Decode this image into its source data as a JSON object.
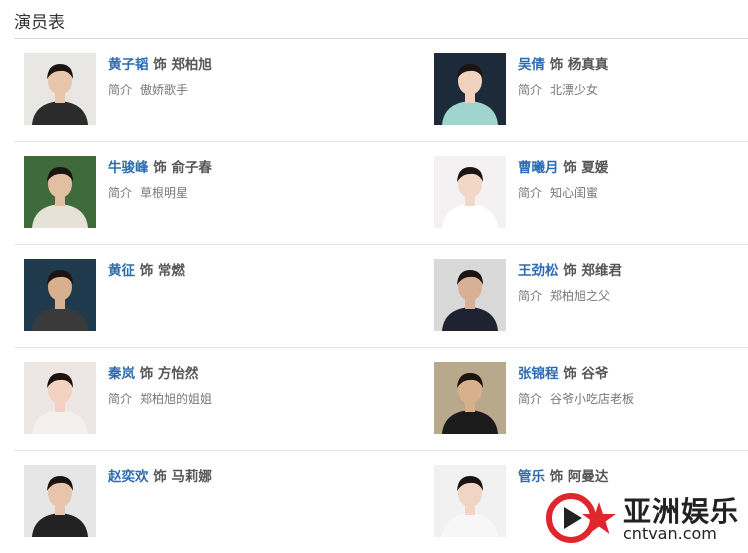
{
  "section_title": "演员表",
  "cast": [
    {
      "actor": "黄子韬",
      "sep": "饰",
      "role": "郑柏旭",
      "intro_label": "简介",
      "intro": "傲娇歌手",
      "photo_bg": "#e9e7e4",
      "photo_fg": "#2b2b2b",
      "skin": "#e8c6ac"
    },
    {
      "actor": "吴倩",
      "sep": "饰",
      "role": "杨真真",
      "intro_label": "简介",
      "intro": "北漂少女",
      "photo_bg": "#1d2a3a",
      "photo_fg": "#9fd4cf",
      "skin": "#f0d2bf"
    },
    {
      "actor": "牛骏峰",
      "sep": "饰",
      "role": "俞子春",
      "intro_label": "简介",
      "intro": "草根明星",
      "photo_bg": "#3f6b3a",
      "photo_fg": "#e7e2d6",
      "skin": "#e3bfa2"
    },
    {
      "actor": "曹曦月",
      "sep": "饰",
      "role": "夏媛",
      "intro_label": "简介",
      "intro": "知心闺蜜",
      "photo_bg": "#f3f1f1",
      "photo_fg": "#ffffff",
      "skin": "#f2d6c6"
    },
    {
      "actor": "黄征",
      "sep": "饰",
      "role": "常燃",
      "intro_label": "",
      "intro": "",
      "photo_bg": "#1e3a4c",
      "photo_fg": "#3a3a3a",
      "skin": "#d9b08e"
    },
    {
      "actor": "王劲松",
      "sep": "饰",
      "role": "郑维君",
      "intro_label": "简介",
      "intro": "郑柏旭之父",
      "photo_bg": "#d9d9d9",
      "photo_fg": "#1f2230",
      "skin": "#d7b095"
    },
    {
      "actor": "秦岚",
      "sep": "饰",
      "role": "方怡然",
      "intro_label": "简介",
      "intro": "郑柏旭的姐姐",
      "photo_bg": "#ece6e4",
      "photo_fg": "#f4f0ee",
      "skin": "#f2d3c2"
    },
    {
      "actor": "张锦程",
      "sep": "饰",
      "role": "谷爷",
      "intro_label": "简介",
      "intro": "谷爷小吃店老板",
      "photo_bg": "#b9a98c",
      "photo_fg": "#1b1b1b",
      "skin": "#d9b08c"
    },
    {
      "actor": "赵奕欢",
      "sep": "饰",
      "role": "马莉娜",
      "intro_label": "",
      "intro": "",
      "photo_bg": "#e6e6e6",
      "photo_fg": "#222222",
      "skin": "#e8c4ac"
    },
    {
      "actor": "管乐",
      "sep": "饰",
      "role": "阿曼达",
      "intro_label": "",
      "intro": "",
      "photo_bg": "#f1f1f1",
      "photo_fg": "#f7f7f7",
      "skin": "#f1d4c4"
    }
  ],
  "watermark": {
    "brand": "亚洲娱乐",
    "url": "cntvan.com",
    "logo_red": "#e0262c",
    "logo_dark": "#222222"
  },
  "colors": {
    "actor_link": "#2b6cb3",
    "divider": "#e6e6e6"
  }
}
